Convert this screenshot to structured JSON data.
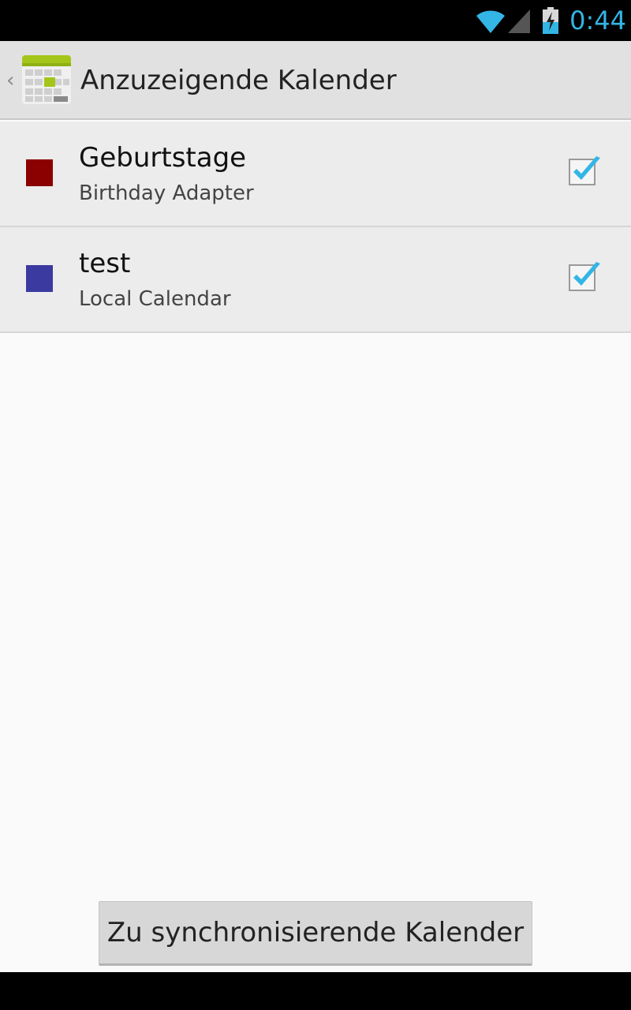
{
  "status_bar": {
    "time": "0:44",
    "icons": [
      "wifi-icon",
      "cell-signal-icon",
      "battery-charging-icon"
    ],
    "accent_color": "#33b5e5"
  },
  "action_bar": {
    "title": "Anzuzeigende Kalender",
    "up_icon": "chevron-left-icon",
    "app_icon": "calendar-app-icon"
  },
  "calendars": [
    {
      "name": "Geburtstage",
      "account": "Birthday Adapter",
      "color": "#8b0000",
      "checked": true
    },
    {
      "name": "test",
      "account": "Local Calendar",
      "color": "#3a3aa0",
      "checked": true
    }
  ],
  "footer": {
    "sync_button_label": "Zu synchronisierende Kalender"
  },
  "colors": {
    "checkmark": "#33b5e5",
    "action_bar_bg": "#e1e1e1",
    "list_bg": "#ececec"
  }
}
